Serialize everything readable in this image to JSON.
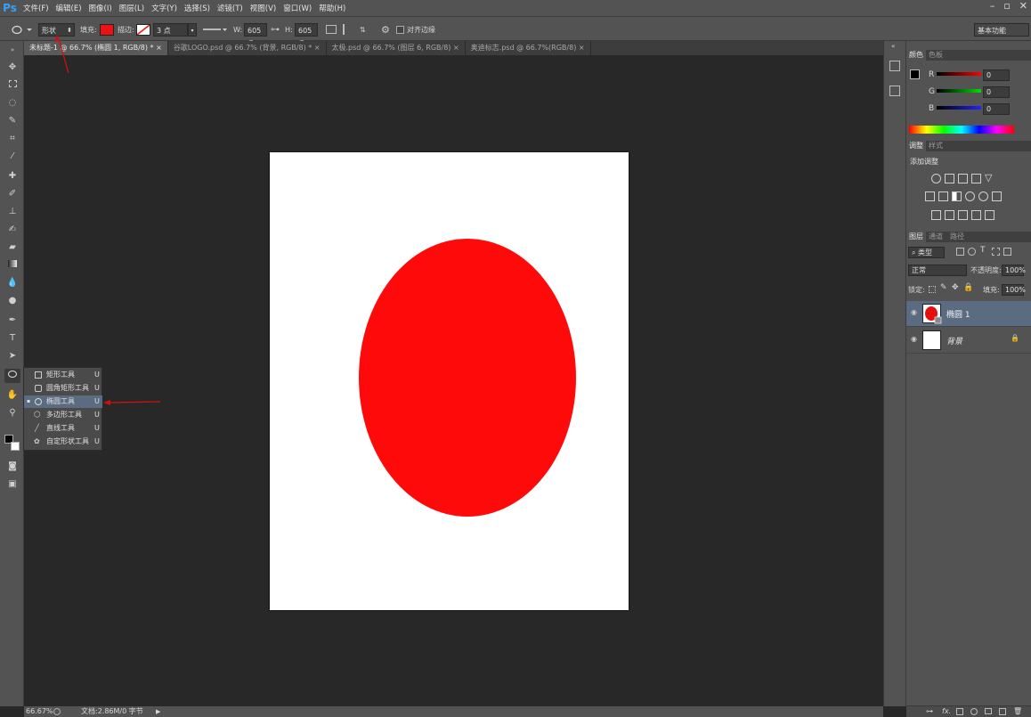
{
  "app": {
    "logo": "Ps"
  },
  "menu": [
    "文件(F)",
    "编辑(E)",
    "图像(I)",
    "图层(L)",
    "文字(Y)",
    "选择(S)",
    "滤镜(T)",
    "视图(V)",
    "窗口(W)",
    "帮助(H)"
  ],
  "window_controls": [
    "–",
    "▫",
    "✕"
  ],
  "options": {
    "mode": "形状",
    "fill_label": "填充:",
    "stroke_label": "描边:",
    "stroke_width": "3 点",
    "w_label": "W:",
    "w_value": "605 像",
    "h_label": "H:",
    "h_value": "605 像",
    "align_edges": "对齐边缘",
    "workspace": "基本功能",
    "fill_color": "#ee1111"
  },
  "tabs": [
    {
      "label": "未标题-1 @ 66.7% (椭圆 1, RGB/8) *",
      "close": "×"
    },
    {
      "label": "谷歌LOGO.psd @ 66.7% (背景, RGB/8) *",
      "close": "×"
    },
    {
      "label": "太极.psd @ 66.7% (图层 6, RGB/8)",
      "close": "×"
    },
    {
      "label": "奥迪标志.psd @ 66.7%(RGB/8)",
      "close": "×"
    }
  ],
  "flyout": {
    "items": [
      {
        "label": "矩形工具",
        "key": "U"
      },
      {
        "label": "圆角矩形工具",
        "key": "U"
      },
      {
        "label": "椭圆工具",
        "key": "U"
      },
      {
        "label": "多边形工具",
        "key": "U"
      },
      {
        "label": "直线工具",
        "key": "U"
      },
      {
        "label": "自定形状工具",
        "key": "U"
      }
    ],
    "selected_marker": "▪"
  },
  "canvas": {
    "ellipse_color": "#ff0a0a"
  },
  "status": {
    "zoom": "66.67%",
    "doc": "文档:2.86M/0 字节"
  },
  "color_panel": {
    "tabs": [
      "颜色",
      "色板"
    ],
    "channels": [
      {
        "name": "R",
        "value": "0"
      },
      {
        "name": "G",
        "value": "0"
      },
      {
        "name": "B",
        "value": "0"
      }
    ]
  },
  "adjust_panel": {
    "tabs": [
      "调整",
      "样式"
    ],
    "title": "添加调整"
  },
  "layers_panel": {
    "tabs": [
      "图层",
      "通道",
      "路径"
    ],
    "kind": "类型",
    "blend": "正常",
    "opacity_label": "不透明度:",
    "opacity": "100%",
    "lock_label": "锁定:",
    "fill_label": "填充:",
    "fill": "100%",
    "layers": [
      {
        "name": "椭圆 1"
      },
      {
        "name": "背景"
      }
    ],
    "footer": "fx."
  }
}
